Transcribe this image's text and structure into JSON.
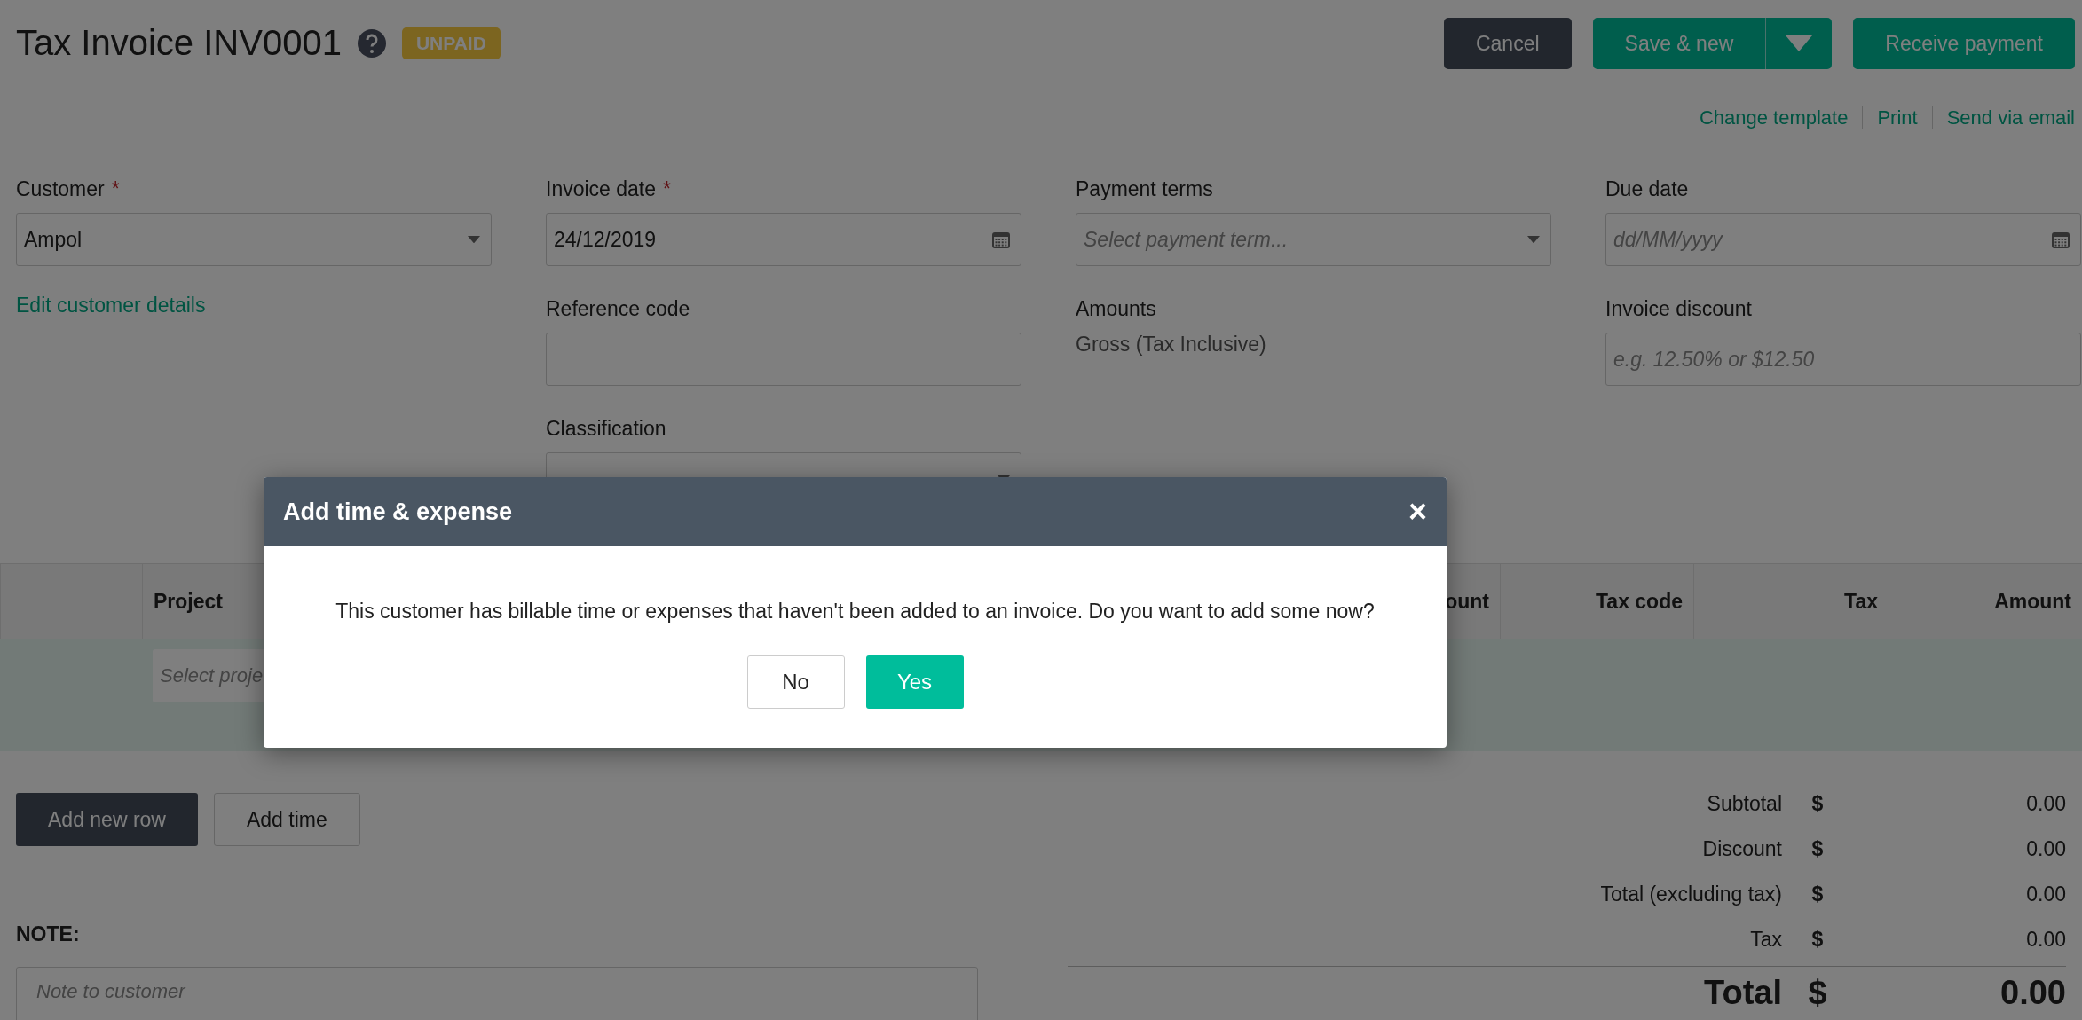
{
  "header": {
    "title": "Tax Invoice INV0001",
    "status_badge": "UNPAID",
    "buttons": [
      {
        "label": "Cancel",
        "kind": "dark"
      },
      {
        "label": "Save & new",
        "kind": "split"
      },
      {
        "label": "Receive payment",
        "kind": "primary"
      }
    ],
    "links": [
      "Change template",
      "Print",
      "Send via email"
    ]
  },
  "form": {
    "columns": [
      [
        {
          "kind": "select",
          "label": "Customer",
          "required_mark": "*",
          "value": "Ampol"
        },
        {
          "kind": "link",
          "label": "Edit customer details"
        }
      ],
      [
        {
          "kind": "date",
          "label": "Invoice date",
          "required_mark": "*",
          "value": "24/12/2019"
        },
        {
          "kind": "input",
          "label": "Reference code"
        },
        {
          "kind": "select",
          "label": "Classification"
        }
      ],
      [
        {
          "kind": "select",
          "label": "Payment terms",
          "placeholder": "Select payment term..."
        },
        {
          "kind": "static",
          "label": "Amounts",
          "value": "Gross (Tax Inclusive)"
        }
      ],
      [
        {
          "kind": "date",
          "label": "Due date",
          "placeholder": "dd/MM/yyyy"
        },
        {
          "kind": "input",
          "label": "Invoice discount",
          "placeholder": "e.g. 12.50% or $12.50"
        }
      ]
    ]
  },
  "table": {
    "columns": [
      "Project",
      "ount",
      "Tax code",
      "Tax",
      "Amount"
    ],
    "row": {
      "project_placeholder": "Select proje"
    }
  },
  "actions": [
    "Add new row",
    "Add time"
  ],
  "note": {
    "label": "NOTE:",
    "placeholder": "Note to customer"
  },
  "totals": [
    {
      "label": "Subtotal",
      "currency": "$",
      "value": "0.00",
      "grand": false
    },
    {
      "label": "Discount",
      "currency": "$",
      "value": "0.00",
      "grand": false
    },
    {
      "label": "Total (excluding tax)",
      "currency": "$",
      "value": "0.00",
      "grand": false
    },
    {
      "label": "Tax",
      "currency": "$",
      "value": "0.00",
      "grand": false
    },
    {
      "label": "Total",
      "currency": "$",
      "value": "0.00",
      "grand": true
    }
  ],
  "modal": {
    "title": "Add time & expense",
    "close": "×",
    "message": "This customer has billable time or expenses that haven't been added to an invoice. Do you want to add some now?",
    "buttons": [
      {
        "label": "No",
        "primary": false
      },
      {
        "label": "Yes",
        "primary": true
      }
    ]
  }
}
